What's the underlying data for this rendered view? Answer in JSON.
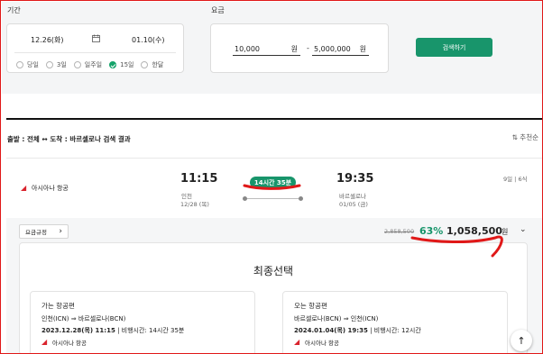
{
  "filters": {
    "period_label": "기간",
    "date_from": "12.26(화)",
    "date_to": "01.10(수)",
    "duration_options": [
      "당일",
      "3일",
      "일주일",
      "15일",
      "한달"
    ],
    "duration_selected_index": 3,
    "price_label": "요금",
    "price_min": "10,000",
    "price_max": "5,000,000",
    "price_unit": "원",
    "price_separator": "-",
    "search_button": "검색하기"
  },
  "results": {
    "route_text": "출발 : 전체 ↔ 도착 : 바르셀로나 검색 결과",
    "sort_label": "추천순"
  },
  "flight": {
    "airline": "아시아나 항공",
    "depart_time": "11:15",
    "depart_city": "인천",
    "depart_date": "12/28 (목)",
    "duration": "14시간 35분",
    "arrive_time": "19:35",
    "arrive_city": "바르셀로나",
    "arrive_date": "01/05 (금)",
    "stay": "9일 | 6식"
  },
  "fare": {
    "rules_button": "요금규정",
    "original_price": "2,858,500",
    "discount": "63%",
    "final_price": "1,058,500",
    "unit": "원"
  },
  "final_selection": {
    "title": "최종선택",
    "outbound": {
      "title": "가는 항공편",
      "route": "인천(ICN)  ⇒  바르셀로나(BCN)",
      "date_time": "2023.12.28(목) 11:15",
      "flight_time": "비행시간: 14시간 35분",
      "airline": "아시아나 항공"
    },
    "inbound": {
      "title": "오는 항공편",
      "route": "바르셀로나(BCN)  ⇒  인천(ICN)",
      "date_time": "2024.01.04(목) 19:35",
      "flight_time": "비행시간: 12시간",
      "airline": "아시아나 항공"
    }
  },
  "colors": {
    "accent": "#18956b",
    "annotation": "#e01818",
    "airline_red": "#d9232d"
  }
}
